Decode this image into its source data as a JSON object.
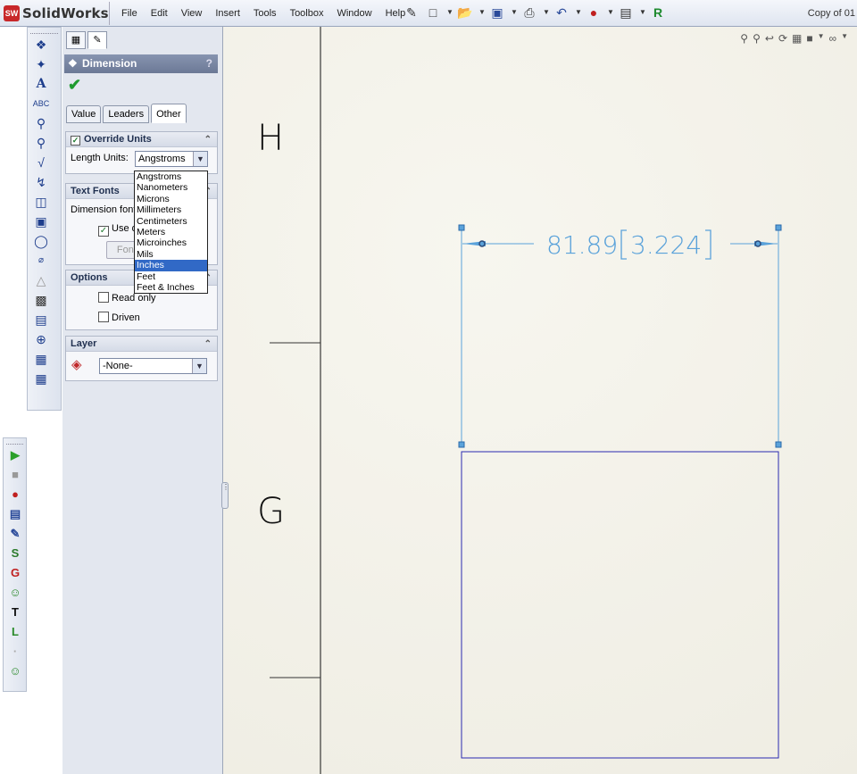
{
  "app": {
    "logo_badge": "SW",
    "logo_text": "SolidWorks",
    "document_title": "Copy of 01"
  },
  "menu": [
    "File",
    "Edit",
    "View",
    "Insert",
    "Tools",
    "Toolbox",
    "Window",
    "Help"
  ],
  "pm": {
    "title": "Dimension",
    "help": "?",
    "tabs": [
      "Value",
      "Leaders",
      "Other"
    ],
    "active_tab": "Other",
    "override_units": {
      "header": "Override Units",
      "checked": true,
      "length_label": "Length Units:",
      "selected": "Angstroms",
      "options": [
        "Angstroms",
        "Nanometers",
        "Microns",
        "Millimeters",
        "Centimeters",
        "Meters",
        "Microinches",
        "Mils",
        "Inches",
        "Feet",
        "Feet & Inches"
      ],
      "highlighted": "Inches"
    },
    "text_fonts": {
      "header": "Text Fonts",
      "dimension_font_label": "Dimension font:",
      "use_doc_label": "Use d",
      "font_button": "Font..."
    },
    "options": {
      "header": "Options",
      "read_only": "Read only",
      "driven": "Driven"
    },
    "layer": {
      "header": "Layer",
      "value": "-None-"
    }
  },
  "drawing": {
    "zone_h": "H",
    "zone_g": "G",
    "dimension_primary": "81.89",
    "dimension_secondary": "3.224"
  },
  "colors": {
    "dimension": "#5aa2da",
    "selection": "#3169c6",
    "rectangle": "#2a2ab0"
  }
}
